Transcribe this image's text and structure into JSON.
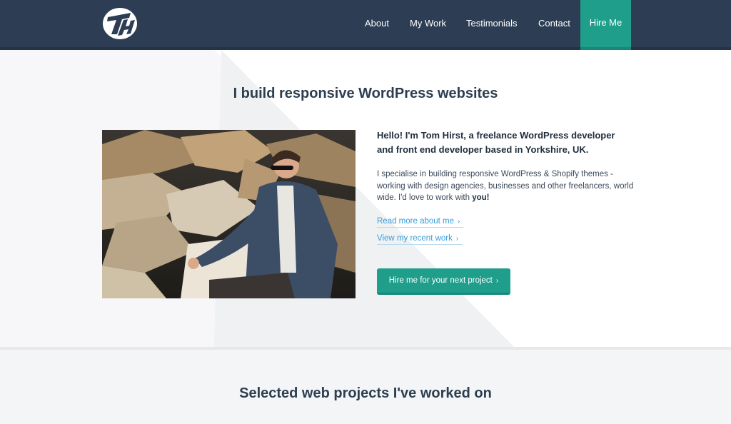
{
  "nav": {
    "logo_label": "TH",
    "items": [
      {
        "label": "About"
      },
      {
        "label": "My Work"
      },
      {
        "label": "Testimonials"
      },
      {
        "label": "Contact"
      }
    ],
    "hire_label": "Hire Me"
  },
  "hero": {
    "title": "I build responsive WordPress websites",
    "intro": "Hello! I'm Tom Hirst, a freelance WordPress developer and front end developer based in Yorkshire, UK.",
    "description": "I specialise in building responsive WordPress & Shopify themes - working with design agencies, businesses and other freelancers, world wide. I'd love to work with",
    "description_emphasis": "you!",
    "link_about": "Read more about me",
    "link_work": "View my recent work",
    "cta_label": "Hire me for your next project",
    "photo_icon": "portrait-photo"
  },
  "projects": {
    "title": "Selected web projects I've worked on"
  },
  "colors": {
    "header_bg": "#2d3e54",
    "accent": "#1e9e8b",
    "link": "#3a9dd9",
    "text_dark": "#2c3e50"
  }
}
